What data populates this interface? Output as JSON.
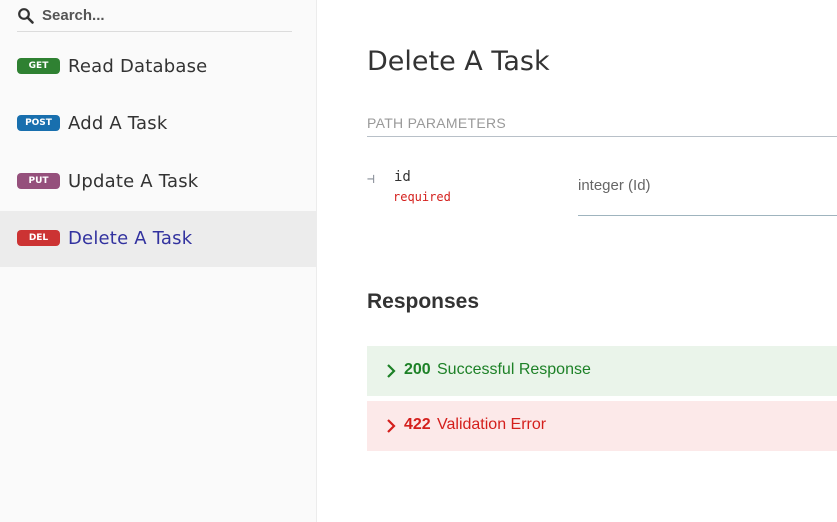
{
  "search": {
    "placeholder": "Search..."
  },
  "sidebar": {
    "items": [
      {
        "method": "GET",
        "label": "Read Database",
        "color": "#2f8132"
      },
      {
        "method": "POST",
        "label": "Add A Task",
        "color": "#186fae"
      },
      {
        "method": "PUT",
        "label": "Update A Task",
        "color": "#95507c"
      },
      {
        "method": "DEL",
        "label": "Delete A Task",
        "color": "#cc3333",
        "active": true
      }
    ]
  },
  "main": {
    "title": "Delete A Task",
    "path_params_label": "PATH PARAMETERS",
    "param": {
      "tree_glyph": "⊣",
      "name": "id",
      "required": "required",
      "type": "integer (Id)"
    },
    "responses_title": "Responses",
    "responses": [
      {
        "code": "200",
        "description": "Successful Response",
        "color": "#1d8127"
      },
      {
        "code": "422",
        "description": "Validation Error",
        "color": "#d41f1c"
      }
    ]
  }
}
